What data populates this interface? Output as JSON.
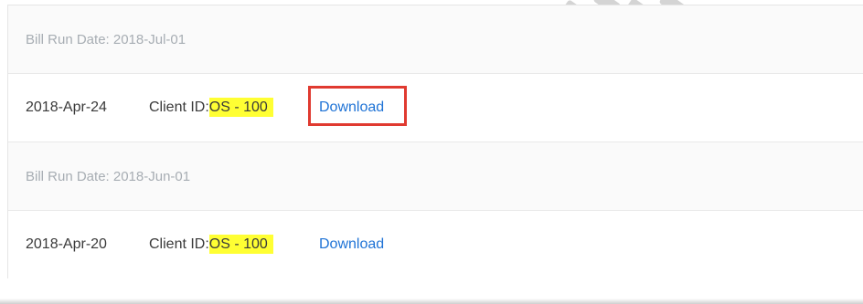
{
  "bill_groups": [
    {
      "header": "Bill Run Date: 2018-Jul-01",
      "record": {
        "date": "2018-Apr-24",
        "client_label": "Client ID:",
        "client_value": "OS - 100",
        "download_label": "Download"
      }
    },
    {
      "header": "Bill Run Date: 2018-Jun-01",
      "record": {
        "date": "2018-Apr-20",
        "client_label": "Client ID:",
        "client_value": "OS - 100",
        "download_label": "Download"
      }
    }
  ],
  "colors": {
    "highlight": "#ffff33",
    "link": "#1f73d6",
    "focus_box": "#e03a30"
  }
}
